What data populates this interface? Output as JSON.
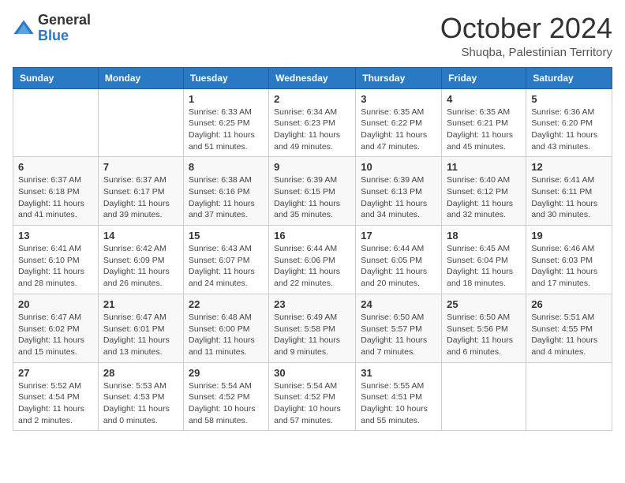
{
  "logo": {
    "text_general": "General",
    "text_blue": "Blue"
  },
  "header": {
    "month": "October 2024",
    "location": "Shuqba, Palestinian Territory"
  },
  "weekdays": [
    "Sunday",
    "Monday",
    "Tuesday",
    "Wednesday",
    "Thursday",
    "Friday",
    "Saturday"
  ],
  "weeks": [
    [
      {
        "day": "",
        "info": ""
      },
      {
        "day": "",
        "info": ""
      },
      {
        "day": "1",
        "info": "Sunrise: 6:33 AM\nSunset: 6:25 PM\nDaylight: 11 hours and 51 minutes."
      },
      {
        "day": "2",
        "info": "Sunrise: 6:34 AM\nSunset: 6:23 PM\nDaylight: 11 hours and 49 minutes."
      },
      {
        "day": "3",
        "info": "Sunrise: 6:35 AM\nSunset: 6:22 PM\nDaylight: 11 hours and 47 minutes."
      },
      {
        "day": "4",
        "info": "Sunrise: 6:35 AM\nSunset: 6:21 PM\nDaylight: 11 hours and 45 minutes."
      },
      {
        "day": "5",
        "info": "Sunrise: 6:36 AM\nSunset: 6:20 PM\nDaylight: 11 hours and 43 minutes."
      }
    ],
    [
      {
        "day": "6",
        "info": "Sunrise: 6:37 AM\nSunset: 6:18 PM\nDaylight: 11 hours and 41 minutes."
      },
      {
        "day": "7",
        "info": "Sunrise: 6:37 AM\nSunset: 6:17 PM\nDaylight: 11 hours and 39 minutes."
      },
      {
        "day": "8",
        "info": "Sunrise: 6:38 AM\nSunset: 6:16 PM\nDaylight: 11 hours and 37 minutes."
      },
      {
        "day": "9",
        "info": "Sunrise: 6:39 AM\nSunset: 6:15 PM\nDaylight: 11 hours and 35 minutes."
      },
      {
        "day": "10",
        "info": "Sunrise: 6:39 AM\nSunset: 6:13 PM\nDaylight: 11 hours and 34 minutes."
      },
      {
        "day": "11",
        "info": "Sunrise: 6:40 AM\nSunset: 6:12 PM\nDaylight: 11 hours and 32 minutes."
      },
      {
        "day": "12",
        "info": "Sunrise: 6:41 AM\nSunset: 6:11 PM\nDaylight: 11 hours and 30 minutes."
      }
    ],
    [
      {
        "day": "13",
        "info": "Sunrise: 6:41 AM\nSunset: 6:10 PM\nDaylight: 11 hours and 28 minutes."
      },
      {
        "day": "14",
        "info": "Sunrise: 6:42 AM\nSunset: 6:09 PM\nDaylight: 11 hours and 26 minutes."
      },
      {
        "day": "15",
        "info": "Sunrise: 6:43 AM\nSunset: 6:07 PM\nDaylight: 11 hours and 24 minutes."
      },
      {
        "day": "16",
        "info": "Sunrise: 6:44 AM\nSunset: 6:06 PM\nDaylight: 11 hours and 22 minutes."
      },
      {
        "day": "17",
        "info": "Sunrise: 6:44 AM\nSunset: 6:05 PM\nDaylight: 11 hours and 20 minutes."
      },
      {
        "day": "18",
        "info": "Sunrise: 6:45 AM\nSunset: 6:04 PM\nDaylight: 11 hours and 18 minutes."
      },
      {
        "day": "19",
        "info": "Sunrise: 6:46 AM\nSunset: 6:03 PM\nDaylight: 11 hours and 17 minutes."
      }
    ],
    [
      {
        "day": "20",
        "info": "Sunrise: 6:47 AM\nSunset: 6:02 PM\nDaylight: 11 hours and 15 minutes."
      },
      {
        "day": "21",
        "info": "Sunrise: 6:47 AM\nSunset: 6:01 PM\nDaylight: 11 hours and 13 minutes."
      },
      {
        "day": "22",
        "info": "Sunrise: 6:48 AM\nSunset: 6:00 PM\nDaylight: 11 hours and 11 minutes."
      },
      {
        "day": "23",
        "info": "Sunrise: 6:49 AM\nSunset: 5:58 PM\nDaylight: 11 hours and 9 minutes."
      },
      {
        "day": "24",
        "info": "Sunrise: 6:50 AM\nSunset: 5:57 PM\nDaylight: 11 hours and 7 minutes."
      },
      {
        "day": "25",
        "info": "Sunrise: 6:50 AM\nSunset: 5:56 PM\nDaylight: 11 hours and 6 minutes."
      },
      {
        "day": "26",
        "info": "Sunrise: 5:51 AM\nSunset: 4:55 PM\nDaylight: 11 hours and 4 minutes."
      }
    ],
    [
      {
        "day": "27",
        "info": "Sunrise: 5:52 AM\nSunset: 4:54 PM\nDaylight: 11 hours and 2 minutes."
      },
      {
        "day": "28",
        "info": "Sunrise: 5:53 AM\nSunset: 4:53 PM\nDaylight: 11 hours and 0 minutes."
      },
      {
        "day": "29",
        "info": "Sunrise: 5:54 AM\nSunset: 4:52 PM\nDaylight: 10 hours and 58 minutes."
      },
      {
        "day": "30",
        "info": "Sunrise: 5:54 AM\nSunset: 4:52 PM\nDaylight: 10 hours and 57 minutes."
      },
      {
        "day": "31",
        "info": "Sunrise: 5:55 AM\nSunset: 4:51 PM\nDaylight: 10 hours and 55 minutes."
      },
      {
        "day": "",
        "info": ""
      },
      {
        "day": "",
        "info": ""
      }
    ]
  ]
}
